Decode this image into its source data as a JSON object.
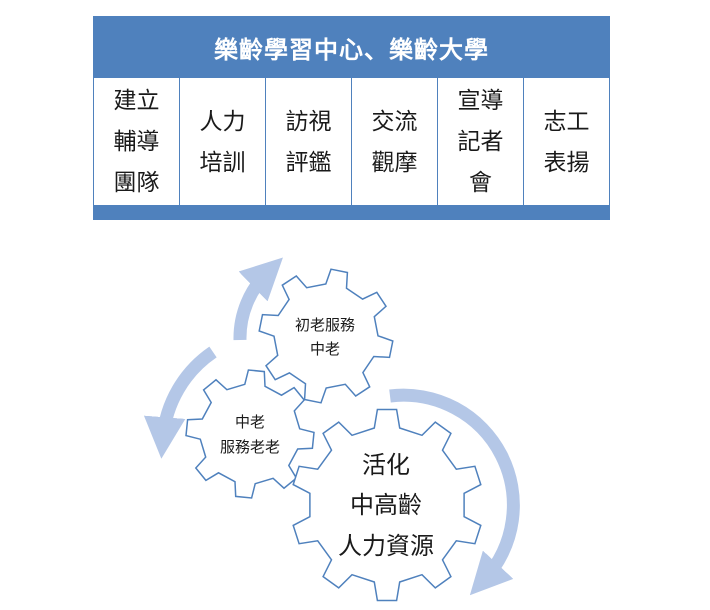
{
  "panel": {
    "title": "樂齡學習中心、樂齡大學",
    "columns": [
      {
        "lines": [
          "建立",
          "輔導",
          "團隊"
        ]
      },
      {
        "lines": [
          "人力",
          "培訓"
        ]
      },
      {
        "lines": [
          "訪視",
          "評鑑"
        ]
      },
      {
        "lines": [
          "交流",
          "觀摩"
        ]
      },
      {
        "lines": [
          "宣導",
          "記者",
          "會"
        ]
      },
      {
        "lines": [
          "志工",
          "表揚"
        ]
      }
    ]
  },
  "gears": {
    "top": {
      "lines": [
        "初老服務",
        "中老"
      ]
    },
    "left": {
      "lines": [
        "中老",
        "服務老老"
      ]
    },
    "big": {
      "lines": [
        "活化",
        "中高齡",
        "人力資源"
      ]
    }
  },
  "colors": {
    "accent": "#4f81bd",
    "gear_stroke": "#4f81bd",
    "arrow": "#b4c7e7"
  }
}
